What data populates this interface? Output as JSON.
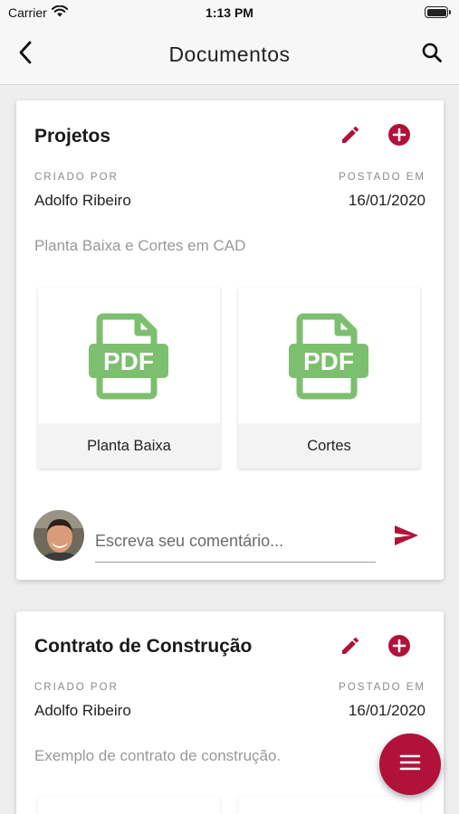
{
  "status_bar": {
    "carrier": "Carrier",
    "time": "1:13 PM"
  },
  "header": {
    "title": "Documentos"
  },
  "colors": {
    "accent": "#b0123a",
    "pdf_green": "#7cbf6e"
  },
  "cards": [
    {
      "title": "Projetos",
      "created_by_label": "CRIADO POR",
      "created_by": "Adolfo Ribeiro",
      "posted_label": "POSTADO EM",
      "posted_on": "16/01/2020",
      "description": "Planta Baixa e Cortes em CAD",
      "files": [
        {
          "icon_text": "PDF",
          "name": "Planta Baixa"
        },
        {
          "icon_text": "PDF",
          "name": "Cortes"
        }
      ],
      "comment_placeholder": "Escreva seu comentário..."
    },
    {
      "title": "Contrato de Construção",
      "created_by_label": "CRIADO POR",
      "created_by": "Adolfo Ribeiro",
      "posted_label": "POSTADO EM",
      "posted_on": "16/01/2020",
      "description": "Exemplo de contrato de construção."
    }
  ],
  "icons": {
    "back": "chevron-left-icon",
    "search": "search-icon",
    "edit": "pencil-icon",
    "add": "plus-circle-icon",
    "file": "pdf-file-icon",
    "send": "send-icon",
    "fab": "menu-icon"
  }
}
